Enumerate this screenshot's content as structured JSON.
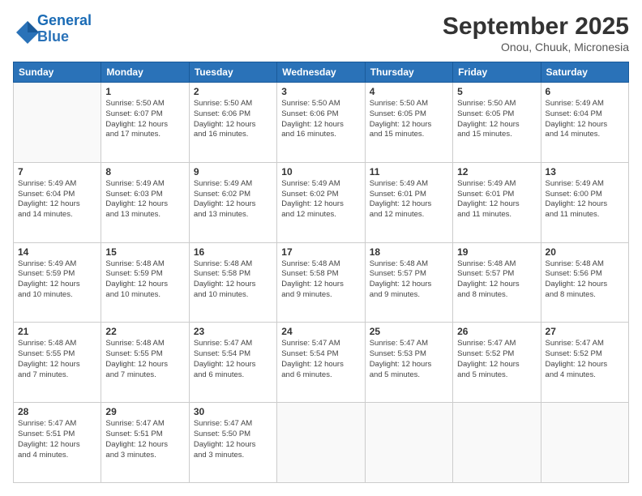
{
  "logo": {
    "line1": "General",
    "line2": "Blue"
  },
  "title": "September 2025",
  "location": "Onou, Chuuk, Micronesia",
  "days_of_week": [
    "Sunday",
    "Monday",
    "Tuesday",
    "Wednesday",
    "Thursday",
    "Friday",
    "Saturday"
  ],
  "weeks": [
    [
      {
        "day": "",
        "info": ""
      },
      {
        "day": "1",
        "info": "Sunrise: 5:50 AM\nSunset: 6:07 PM\nDaylight: 12 hours\nand 17 minutes."
      },
      {
        "day": "2",
        "info": "Sunrise: 5:50 AM\nSunset: 6:06 PM\nDaylight: 12 hours\nand 16 minutes."
      },
      {
        "day": "3",
        "info": "Sunrise: 5:50 AM\nSunset: 6:06 PM\nDaylight: 12 hours\nand 16 minutes."
      },
      {
        "day": "4",
        "info": "Sunrise: 5:50 AM\nSunset: 6:05 PM\nDaylight: 12 hours\nand 15 minutes."
      },
      {
        "day": "5",
        "info": "Sunrise: 5:50 AM\nSunset: 6:05 PM\nDaylight: 12 hours\nand 15 minutes."
      },
      {
        "day": "6",
        "info": "Sunrise: 5:49 AM\nSunset: 6:04 PM\nDaylight: 12 hours\nand 14 minutes."
      }
    ],
    [
      {
        "day": "7",
        "info": "Sunrise: 5:49 AM\nSunset: 6:04 PM\nDaylight: 12 hours\nand 14 minutes."
      },
      {
        "day": "8",
        "info": "Sunrise: 5:49 AM\nSunset: 6:03 PM\nDaylight: 12 hours\nand 13 minutes."
      },
      {
        "day": "9",
        "info": "Sunrise: 5:49 AM\nSunset: 6:02 PM\nDaylight: 12 hours\nand 13 minutes."
      },
      {
        "day": "10",
        "info": "Sunrise: 5:49 AM\nSunset: 6:02 PM\nDaylight: 12 hours\nand 12 minutes."
      },
      {
        "day": "11",
        "info": "Sunrise: 5:49 AM\nSunset: 6:01 PM\nDaylight: 12 hours\nand 12 minutes."
      },
      {
        "day": "12",
        "info": "Sunrise: 5:49 AM\nSunset: 6:01 PM\nDaylight: 12 hours\nand 11 minutes."
      },
      {
        "day": "13",
        "info": "Sunrise: 5:49 AM\nSunset: 6:00 PM\nDaylight: 12 hours\nand 11 minutes."
      }
    ],
    [
      {
        "day": "14",
        "info": "Sunrise: 5:49 AM\nSunset: 5:59 PM\nDaylight: 12 hours\nand 10 minutes."
      },
      {
        "day": "15",
        "info": "Sunrise: 5:48 AM\nSunset: 5:59 PM\nDaylight: 12 hours\nand 10 minutes."
      },
      {
        "day": "16",
        "info": "Sunrise: 5:48 AM\nSunset: 5:58 PM\nDaylight: 12 hours\nand 10 minutes."
      },
      {
        "day": "17",
        "info": "Sunrise: 5:48 AM\nSunset: 5:58 PM\nDaylight: 12 hours\nand 9 minutes."
      },
      {
        "day": "18",
        "info": "Sunrise: 5:48 AM\nSunset: 5:57 PM\nDaylight: 12 hours\nand 9 minutes."
      },
      {
        "day": "19",
        "info": "Sunrise: 5:48 AM\nSunset: 5:57 PM\nDaylight: 12 hours\nand 8 minutes."
      },
      {
        "day": "20",
        "info": "Sunrise: 5:48 AM\nSunset: 5:56 PM\nDaylight: 12 hours\nand 8 minutes."
      }
    ],
    [
      {
        "day": "21",
        "info": "Sunrise: 5:48 AM\nSunset: 5:55 PM\nDaylight: 12 hours\nand 7 minutes."
      },
      {
        "day": "22",
        "info": "Sunrise: 5:48 AM\nSunset: 5:55 PM\nDaylight: 12 hours\nand 7 minutes."
      },
      {
        "day": "23",
        "info": "Sunrise: 5:47 AM\nSunset: 5:54 PM\nDaylight: 12 hours\nand 6 minutes."
      },
      {
        "day": "24",
        "info": "Sunrise: 5:47 AM\nSunset: 5:54 PM\nDaylight: 12 hours\nand 6 minutes."
      },
      {
        "day": "25",
        "info": "Sunrise: 5:47 AM\nSunset: 5:53 PM\nDaylight: 12 hours\nand 5 minutes."
      },
      {
        "day": "26",
        "info": "Sunrise: 5:47 AM\nSunset: 5:52 PM\nDaylight: 12 hours\nand 5 minutes."
      },
      {
        "day": "27",
        "info": "Sunrise: 5:47 AM\nSunset: 5:52 PM\nDaylight: 12 hours\nand 4 minutes."
      }
    ],
    [
      {
        "day": "28",
        "info": "Sunrise: 5:47 AM\nSunset: 5:51 PM\nDaylight: 12 hours\nand 4 minutes."
      },
      {
        "day": "29",
        "info": "Sunrise: 5:47 AM\nSunset: 5:51 PM\nDaylight: 12 hours\nand 3 minutes."
      },
      {
        "day": "30",
        "info": "Sunrise: 5:47 AM\nSunset: 5:50 PM\nDaylight: 12 hours\nand 3 minutes."
      },
      {
        "day": "",
        "info": ""
      },
      {
        "day": "",
        "info": ""
      },
      {
        "day": "",
        "info": ""
      },
      {
        "day": "",
        "info": ""
      }
    ]
  ]
}
